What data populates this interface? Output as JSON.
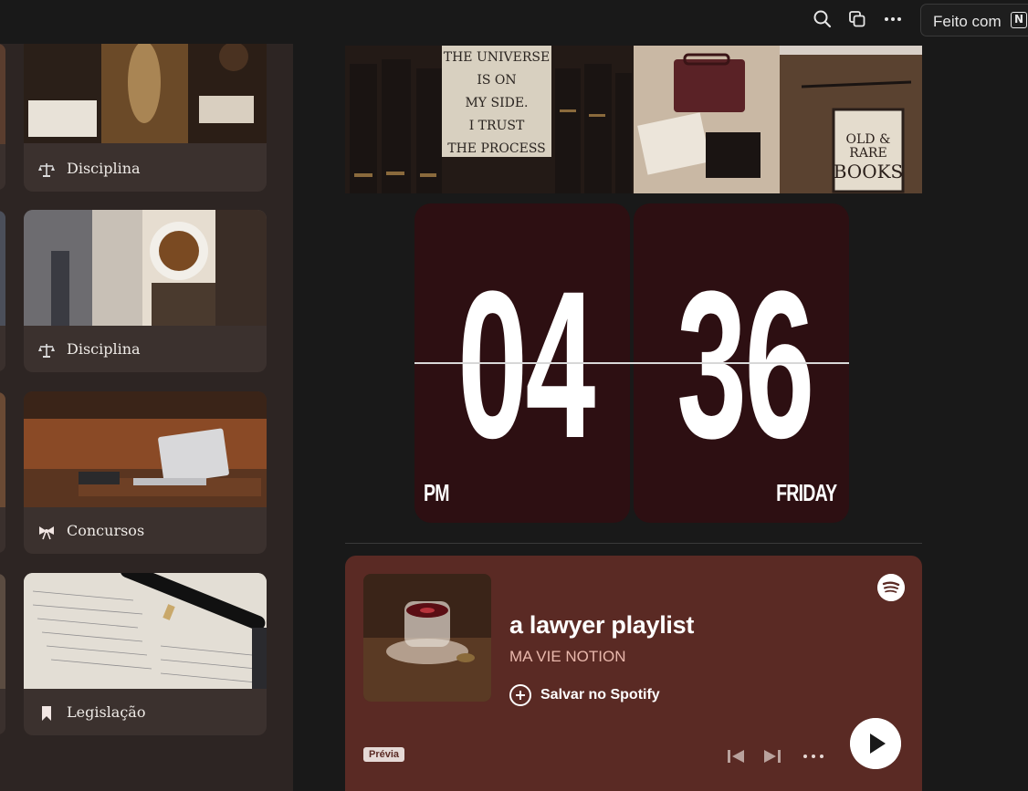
{
  "topbar": {
    "icons": [
      "search-icon",
      "duplicate-icon",
      "more-icon"
    ],
    "made_with_label": "Feito com",
    "notion_logo": "N"
  },
  "sidebar": {
    "cards": [
      {
        "label": "Disciplina",
        "icon": "scales-icon"
      },
      {
        "label": "Disciplina",
        "icon": "scales-icon"
      },
      {
        "label": "Concursos",
        "icon": "bow-icon"
      },
      {
        "label": "Legislação",
        "icon": "bookmark-icon"
      }
    ]
  },
  "banner": {
    "quote_lines": [
      "THE UNIVERSE",
      "IS ON",
      "MY SIDE.",
      "I TRUST",
      "THE PROCESS"
    ],
    "sign_lines": [
      "OLD &",
      "RARE",
      "BOOKS"
    ]
  },
  "clock": {
    "hours": "04",
    "minutes": "36",
    "period": "PM",
    "weekday": "FRIDAY"
  },
  "spotify": {
    "title": "a lawyer playlist",
    "artist": "MA VIE NOTION",
    "save_label": "Salvar no Spotify",
    "preview_badge": "Prévia",
    "colors": {
      "background": "#5a2a24",
      "artist_text": "#e9b8ac"
    }
  }
}
